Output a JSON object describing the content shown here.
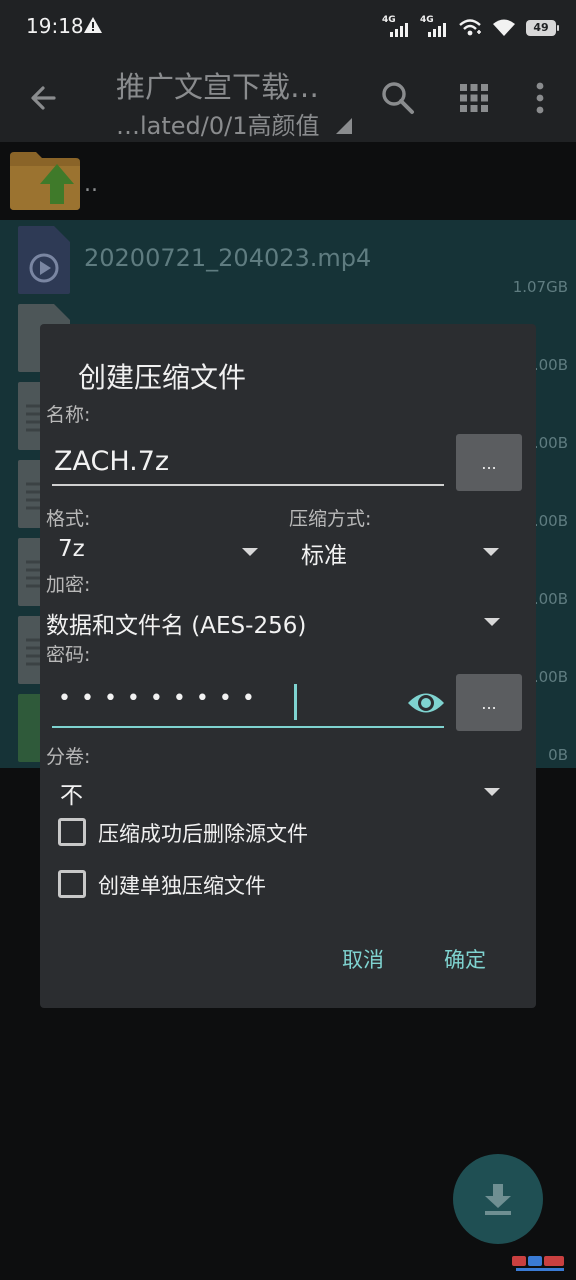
{
  "status_bar": {
    "time": "19:18",
    "network_1": "4G",
    "network_2": "4G",
    "battery": "49"
  },
  "app_bar": {
    "title": "推广文宣下载…",
    "subtitle": "…lated/0/1高颜值"
  },
  "file_list": {
    "parent_label": "..",
    "items": [
      {
        "name": "20200721_204023.mp4",
        "size": "1.07GB",
        "icon": "video-file-icon"
      },
      {
        "name": "",
        "size": ".00B",
        "icon": "file-icon"
      },
      {
        "name": "",
        "size": ".00B",
        "icon": "text-file-icon"
      },
      {
        "name": "",
        "size": ".00B",
        "icon": "text-file-icon"
      },
      {
        "name": "",
        "size": ".00B",
        "icon": "text-file-icon"
      },
      {
        "name": "",
        "size": ".00B",
        "icon": "text-file-icon"
      },
      {
        "name": "",
        "size": "0B",
        "icon": "image-file-icon"
      }
    ]
  },
  "dialog": {
    "title": "创建压缩文件",
    "name_label": "名称:",
    "name_value": "ZACH.7z",
    "browse_label": "...",
    "format_label": "格式:",
    "format_value": "7z",
    "method_label": "压缩方式:",
    "method_value": "标准",
    "encryption_label": "加密:",
    "encryption_value": "数据和文件名 (AES-256)",
    "password_label": "密码:",
    "password_value": "•••••••••",
    "password_more_label": "...",
    "split_label": "分卷:",
    "split_value": "不",
    "delete_after_label": "压缩成功后删除源文件",
    "separate_archives_label": "创建单独压缩文件",
    "cancel_label": "取消",
    "ok_label": "确定"
  },
  "colors": {
    "accent": "#7fd3d0",
    "dialog_bg": "#2b2d30",
    "appbar_bg": "#202224",
    "selection_bg": "#163337"
  }
}
